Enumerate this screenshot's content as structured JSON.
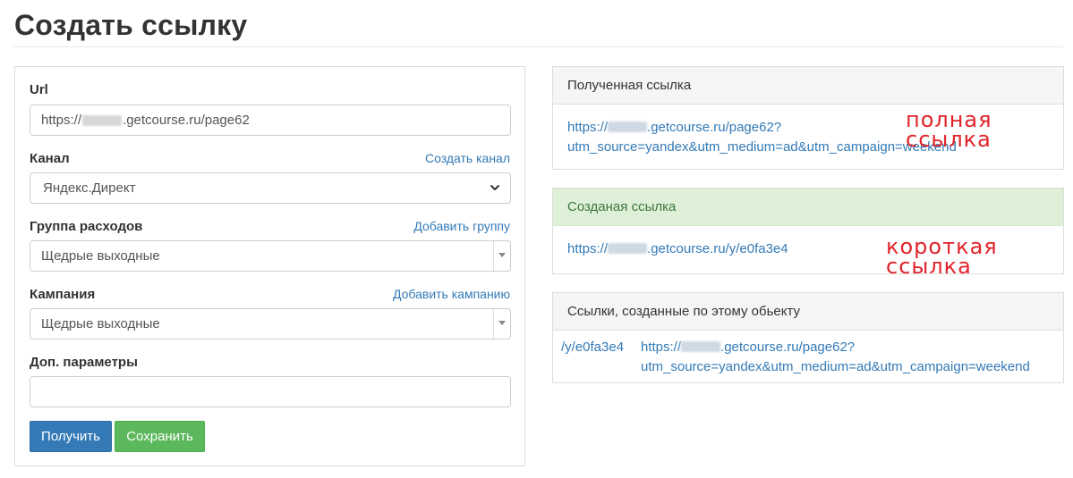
{
  "page_title": "Создать ссылку",
  "form": {
    "url_label": "Url",
    "url_value_prefix": "https://",
    "url_value_suffix": ".getcourse.ru/page62",
    "channel_label": "Канал",
    "channel_link": "Создать канал",
    "channel_value": "Яндекс.Директ",
    "expense_group_label": "Группа расходов",
    "expense_group_link": "Добавить группу",
    "expense_group_value": "Щедрые выходные",
    "campaign_label": "Кампания",
    "campaign_link": "Добавить кампанию",
    "campaign_value": "Щедрые выходные",
    "extra_params_label": "Доп. параметры",
    "extra_params_value": "",
    "get_button": "Получить",
    "save_button": "Сохранить"
  },
  "result_panel": {
    "heading": "Полученная ссылка",
    "link_line1_prefix": "https://",
    "link_line1_suffix": ".getcourse.ru/page62?",
    "link_line2": "utm_source=yandex&utm_medium=ad&utm_campaign=weekend",
    "annotation": "полная ссылка"
  },
  "created_panel": {
    "heading": "Созданая ссылка",
    "link_prefix": "https://",
    "link_suffix": ".getcourse.ru/y/e0fa3e4",
    "annotation": "короткая ссылка"
  },
  "object_links_panel": {
    "heading": "Ссылки, созданные по этому обьекту",
    "short_link": "/y/e0fa3e4",
    "full_line1_prefix": "https://",
    "full_line1_suffix": ".getcourse.ru/page62?",
    "full_line2": "utm_source=yandex&utm_medium=ad&utm_campaign=weekend"
  },
  "colors": {
    "primary": "#337ab7",
    "success": "#5cb85c",
    "annotation_red": "#e0242a",
    "success_panel_bg": "#dff0d8"
  }
}
